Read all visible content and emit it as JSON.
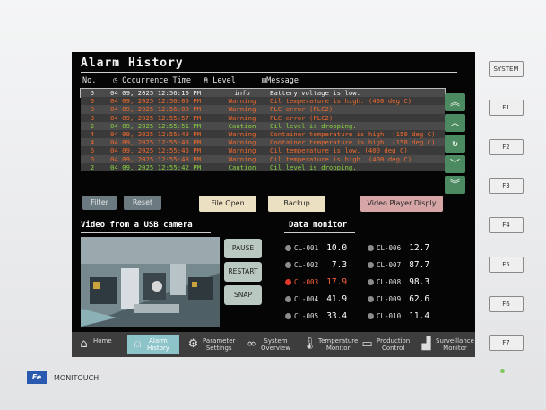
{
  "screen": {
    "title": "Alarm History",
    "headers": {
      "no": "No.",
      "time": "Occurrence Time",
      "level": "Level",
      "message": "Message"
    }
  },
  "alarms": [
    {
      "no": "5",
      "time": "04 09, 2025 12:56:10 PM",
      "level": "info",
      "message": "Battery voltage is low.",
      "color": "#f0f0f0"
    },
    {
      "no": "0",
      "time": "04 09, 2025 12:56:05 PM",
      "level": "Warning",
      "message": "Oil temperature is high. (400 deg C)",
      "color": "#f26a2e"
    },
    {
      "no": "3",
      "time": "04 09, 2025 12:56:00 PM",
      "level": "Warning",
      "message": "PLC error (PLC2)",
      "color": "#f26a2e"
    },
    {
      "no": "3",
      "time": "04 09, 2025 12:55:57 PM",
      "level": "Warning",
      "message": "PLC error (PLC2)",
      "color": "#f26a2e"
    },
    {
      "no": "2",
      "time": "04 09, 2025 12:55:51 PM",
      "level": "Caution",
      "message": "Oil level is dropping.",
      "color": "#8bd040"
    },
    {
      "no": "4",
      "time": "04 09, 2025 12:55:49 PM",
      "level": "Warning",
      "message": "Container temperature is high. (150 deg C)",
      "color": "#f26a2e"
    },
    {
      "no": "4",
      "time": "04 09, 2025 12:55:48 PM",
      "level": "Warning",
      "message": "Container temperature is high. (150 deg C)",
      "color": "#f26a2e"
    },
    {
      "no": "6",
      "time": "04 09, 2025 12:55:46 PM",
      "level": "Warning",
      "message": "Oil temperature is low. (400 deg C)",
      "color": "#f26a2e"
    },
    {
      "no": "0",
      "time": "04 09, 2025 12:55:43 PM",
      "level": "Warning",
      "message": "Oil temperature is high. (400 deg C)",
      "color": "#f26a2e"
    },
    {
      "no": "2",
      "time": "04 09, 2025 12:55:42 PM",
      "level": "Caution",
      "message": "Oil level is dropping.",
      "color": "#8bd040"
    }
  ],
  "buttons": {
    "filter": "Filter",
    "reset": "Reset",
    "file_open": "File Open",
    "backup": "Backup",
    "video_player": "Video Player Disply"
  },
  "video": {
    "title": "Video from a USB camera",
    "pause": "PAUSE",
    "restart": "RESTART",
    "snap": "SNAP"
  },
  "data_monitor": {
    "title": "Data monitor",
    "items": [
      {
        "label": "CL-001",
        "value": "10.0",
        "alert": false
      },
      {
        "label": "CL-002",
        "value": "7.3",
        "alert": false
      },
      {
        "label": "CL-003",
        "value": "17.9",
        "alert": true
      },
      {
        "label": "CL-004",
        "value": "41.9",
        "alert": false
      },
      {
        "label": "CL-005",
        "value": "33.4",
        "alert": false
      },
      {
        "label": "CL-006",
        "value": "12.7",
        "alert": false
      },
      {
        "label": "CL-007",
        "value": "87.7",
        "alert": false
      },
      {
        "label": "CL-008",
        "value": "98.3",
        "alert": false
      },
      {
        "label": "CL-009",
        "value": "62.6",
        "alert": false
      },
      {
        "label": "CL-010",
        "value": "11.4",
        "alert": false
      }
    ]
  },
  "nav": [
    {
      "line1": "Home",
      "line2": "",
      "icon": "home-icon",
      "active": false
    },
    {
      "line1": "Alarm",
      "line2": "History",
      "icon": "bell-icon",
      "active": true
    },
    {
      "line1": "Parameter",
      "line2": "Settings",
      "icon": "gear-icon",
      "active": false
    },
    {
      "line1": "System",
      "line2": "Overview",
      "icon": "binoculars-icon",
      "active": false
    },
    {
      "line1": "Temperature",
      "line2": "Monitor",
      "icon": "thermometer-icon",
      "active": false
    },
    {
      "line1": "Production",
      "line2": "Control",
      "icon": "production-icon",
      "active": false
    },
    {
      "line1": "Surveillance",
      "line2": "Monitor",
      "icon": "factory-icon",
      "active": false
    }
  ],
  "side_keys": [
    "SYSTEM",
    "F1",
    "F2",
    "F3",
    "F4",
    "F5",
    "F6",
    "F7"
  ],
  "brand": "MONITOUCH",
  "logo_text": "Fe"
}
